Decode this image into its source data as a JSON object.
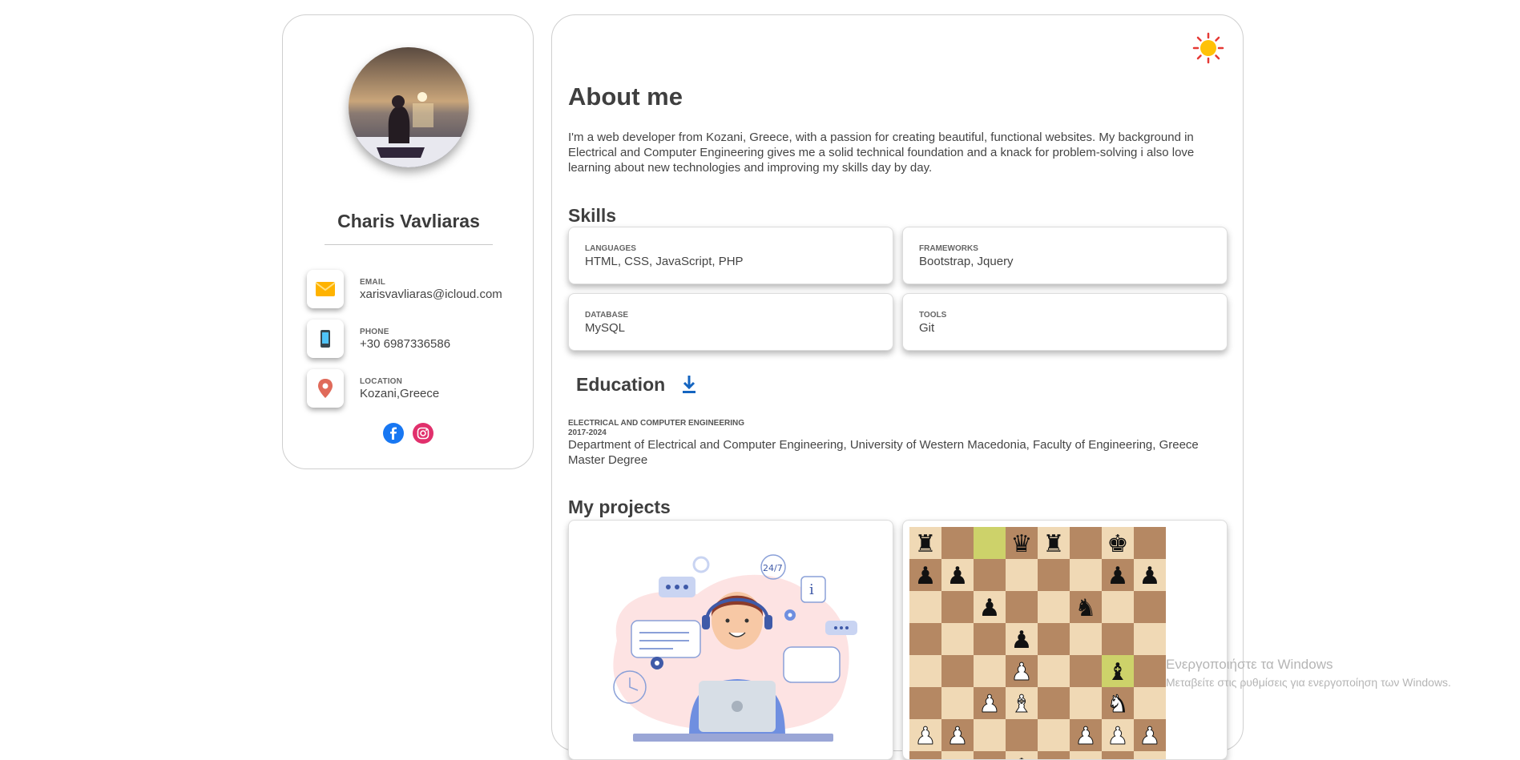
{
  "profile": {
    "name": "Charis Vavliaras",
    "contacts": [
      {
        "label": "EMAIL",
        "value": "xarisvavliaras@icloud.com",
        "icon": "envelope-icon"
      },
      {
        "label": "PHONE",
        "value": "+30 6987336586",
        "icon": "phone-icon"
      },
      {
        "label": "LOCATION",
        "value": "Kozani,Greece",
        "icon": "map-pin-icon"
      }
    ],
    "social": [
      {
        "name": "facebook",
        "icon": "facebook-icon",
        "color": "#1877f2"
      },
      {
        "name": "instagram",
        "icon": "instagram-icon",
        "color": "#e1306c"
      }
    ]
  },
  "theme": {
    "icon": "sun-icon"
  },
  "about": {
    "title": "About me",
    "text": "I'm a web developer from Kozani, Greece, with a passion for creating beautiful, functional websites. My background in Electrical and Computer Engineering gives me a solid technical foundation and a knack for problem-solving i also love learning about new technologies and improving my skills day by day."
  },
  "skills": {
    "title": "Skills",
    "items": [
      {
        "label": "LANGUAGES",
        "value": "HTML, CSS, JavaScript, PHP"
      },
      {
        "label": "FRAMEWORKS",
        "value": "Bootstrap, Jquery"
      },
      {
        "label": "DATABASE",
        "value": "MySQL"
      },
      {
        "label": "TOOLS",
        "value": "Git"
      }
    ]
  },
  "education": {
    "title": "Education",
    "download_icon": "download-icon",
    "degree": "ELECTRICAL AND COMPUTER ENGINEERING",
    "years": "2017-2024",
    "description": "Department of Electrical and Computer Engineering, University of Western Macedonia, Faculty of Engineering, Greece Master Degree"
  },
  "projects": {
    "title": "My projects",
    "items": [
      {
        "image": "support-agent-illustration",
        "badge": "24/7"
      },
      {
        "image": "chess-board-screenshot"
      }
    ]
  },
  "watermark": {
    "line1": "Ενεργοποιήστε τα Windows",
    "line2": "Μεταβείτε στις ρυθμίσεις για ενεργοποίηση των Windows."
  },
  "colors": {
    "accent": "#1565c0",
    "sun": "#ffc107",
    "sun_rays": "#e53935"
  }
}
